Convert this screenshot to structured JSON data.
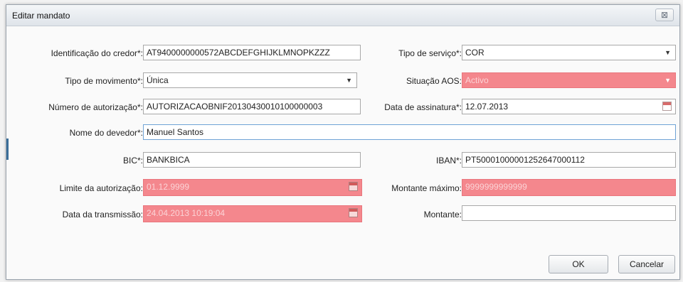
{
  "dialog": {
    "title": "Editar mandato",
    "close_glyph": "⊠"
  },
  "fields": {
    "creditor_id": {
      "label": "Identificação do credor*:",
      "value": "AT9400000000572ABCDEFGHIJKLMNOPKZZZ"
    },
    "service_type": {
      "label": "Tipo de serviço*:",
      "value": "COR"
    },
    "movement_type": {
      "label": "Tipo de movimento*:",
      "value": "Única"
    },
    "aos_status": {
      "label": "Situação AOS:",
      "value": "Activo"
    },
    "authorization_number": {
      "label": "Número de autorização*:",
      "value": "AUTORIZACAOBNIF20130430010100000003"
    },
    "signature_date": {
      "label": "Data de assinatura*:",
      "value": "12.07.2013"
    },
    "debtor_name": {
      "label": "Nome do devedor*:",
      "value": "Manuel Santos"
    },
    "bic": {
      "label": "BIC*:",
      "value": "BANKBICA"
    },
    "iban": {
      "label": "IBAN*:",
      "value": "PT50001000001252647000112"
    },
    "authorization_limit": {
      "label": "Limite da autorização:",
      "value": "01.12.9999"
    },
    "max_amount": {
      "label": "Montante máximo:",
      "value": "9999999999999"
    },
    "transmission_date": {
      "label": "Data da transmissão:",
      "value": "24.04.2013 10:19:04"
    },
    "amount": {
      "label": "Montante:",
      "value": ""
    }
  },
  "buttons": {
    "ok": "OK",
    "cancel": "Cancelar"
  },
  "icons": {
    "dropdown": "chevron-down-icon",
    "calendar": "calendar-icon",
    "close": "close-icon"
  },
  "colors": {
    "disabled_field_bg": "#f4878d",
    "focus_border": "#6fa3d6"
  }
}
